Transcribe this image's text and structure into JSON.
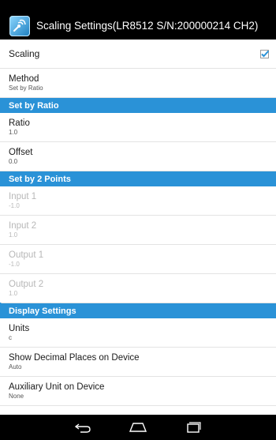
{
  "actionbar": {
    "title": "Scaling Settings(LR8512 S/N:200000214 CH2)",
    "app_icon": "wave-sensor-app-icon"
  },
  "items": {
    "scaling": {
      "title": "Scaling",
      "checked": true
    },
    "method": {
      "title": "Method",
      "value": "Set by Ratio"
    },
    "ratio": {
      "title": "Ratio",
      "value": "1.0"
    },
    "offset": {
      "title": "Offset",
      "value": "0.0"
    },
    "input1": {
      "title": "Input 1",
      "value": "-1.0"
    },
    "input2": {
      "title": "Input 2",
      "value": "1.0"
    },
    "output1": {
      "title": "Output 1",
      "value": "-1.0"
    },
    "output2": {
      "title": "Output 2",
      "value": "1.0"
    },
    "units": {
      "title": "Units",
      "value": "c"
    },
    "decimal": {
      "title": "Show Decimal Places on Device",
      "value": "Auto"
    },
    "aux": {
      "title": "Auxiliary Unit on Device",
      "value": "None"
    }
  },
  "sections": {
    "ratio": "Set by Ratio",
    "points": "Set by 2 Points",
    "display": "Display Settings"
  },
  "navbar": {
    "back": "back-icon",
    "home": "home-icon",
    "recents": "recents-icon"
  },
  "colors": {
    "section": "#2a92d7",
    "checkbox": "#2a92d7",
    "bars": "#000000"
  }
}
